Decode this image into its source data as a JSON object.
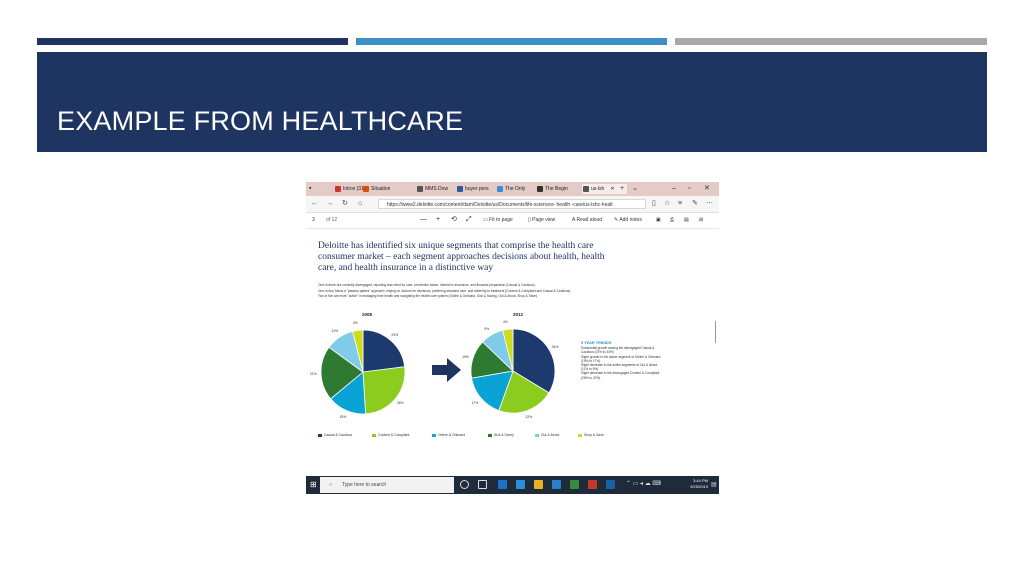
{
  "slide": {
    "title": "EXAMPLE FROM HEALTHCARE",
    "accent_colors": {
      "navy": "#1e3461",
      "blue": "#3b8fc4",
      "gray": "#a8a8a8"
    }
  },
  "browser": {
    "tabs": [
      {
        "label": "Inbox (31",
        "icon": "mail-icon",
        "color": "#c0392b"
      },
      {
        "label": "Situation",
        "icon": "chrome-icon",
        "color": "#d35400"
      },
      {
        "label": "MMS Dow",
        "icon": "page-icon",
        "color": "#555555"
      },
      {
        "label": "buyer pers",
        "icon": "b-icon",
        "color": "#2c5aa0"
      },
      {
        "label": "The Only",
        "icon": "page-icon",
        "color": "#3a8fd0"
      },
      {
        "label": "The Begin",
        "icon": "stack-icon",
        "color": "#333333"
      },
      {
        "label": "us-lsh",
        "icon": "doc-icon",
        "color": "#555555",
        "active": true
      }
    ],
    "url": "https://www2.deloitte.com/content/dam/Deloitte/us/Documents/life-sciences- health -care/us-lshc-healt",
    "pdf_toolbar": {
      "page_current": "3",
      "page_total": "of 12",
      "fit_label": "Fit to page",
      "view_label": "Page view",
      "read_label": "Read aloud",
      "notes_label": "Add notes"
    }
  },
  "document": {
    "heading": "Deloitte has identified six unique segments that comprise the health care consumer market – each segment approaches decisions about health, health care, and health insurance in a distinctive way",
    "bullets": [
      "One-in-three are currently disengaged, reporting less need for care, preventive action, interest in insurance, and financial preparation (Casual & Cautious).",
      "One-in-four follow a \"passive-patient\" approach, relying on doctors for decisions, preferring standard care, and adhering to treatment (Content & Compliant and Casual & Cautious).",
      "Two in five are more \"active\" in managing their health and navigating the health care system (Online & Onboard, Sick & Saving, Out & About, Shop & Save)."
    ],
    "trends": {
      "title": "5 YEAR TRENDS",
      "items": [
        "Substantial growth among the disengaged Casual & Cautious (23% to 34%)",
        "Slight growth in the active segment of Online & Onboard (15% to 17%)",
        "Slight decrease in the active segments of Out & About (11% to 9%)",
        "Slight decrease in the disengaged Content & Compliant (26% to 22%)"
      ]
    }
  },
  "chart_data": [
    {
      "type": "pie",
      "title": "2008",
      "categories": [
        "Casual & Cautious",
        "Content & Compliant",
        "Online & Onboard",
        "Sick & Savvy",
        "Out & About",
        "Shop & Save"
      ],
      "values": [
        23,
        26,
        15,
        21,
        11,
        4
      ],
      "labels": [
        "23%",
        "26%",
        "15%",
        "21%",
        "11%",
        "4%"
      ],
      "colors": [
        "#1c3a6e",
        "#8ccc1e",
        "#0aa3d6",
        "#2f7a33",
        "#7fcbe8",
        "#cddc1e"
      ]
    },
    {
      "type": "pie",
      "title": "2012",
      "categories": [
        "Casual & Cautious",
        "Content & Compliant",
        "Online & Onboard",
        "Sick & Savvy",
        "Out & About",
        "Shop & Save"
      ],
      "values": [
        34,
        22,
        17,
        15,
        9,
        4
      ],
      "labels": [
        "34%",
        "22%",
        "17%",
        "15%",
        "9%",
        "4%"
      ],
      "colors": [
        "#1c3a6e",
        "#8ccc1e",
        "#0aa3d6",
        "#2f7a33",
        "#7fcbe8",
        "#cddc1e"
      ]
    }
  ],
  "legend": [
    {
      "label": "Casual & Cautious",
      "color": "#1c3a6e"
    },
    {
      "label": "Content & Compliant",
      "color": "#8ccc1e"
    },
    {
      "label": "Online & Onboard",
      "color": "#0aa3d6"
    },
    {
      "label": "Sick & Savvy",
      "color": "#2f7a33"
    },
    {
      "label": "Out & About",
      "color": "#7fcbe8"
    },
    {
      "label": "Shop & Save",
      "color": "#cddc1e"
    }
  ],
  "taskbar": {
    "search_placeholder": "Type here to search",
    "time": "3:44 PM",
    "date": "9/25/2019"
  }
}
